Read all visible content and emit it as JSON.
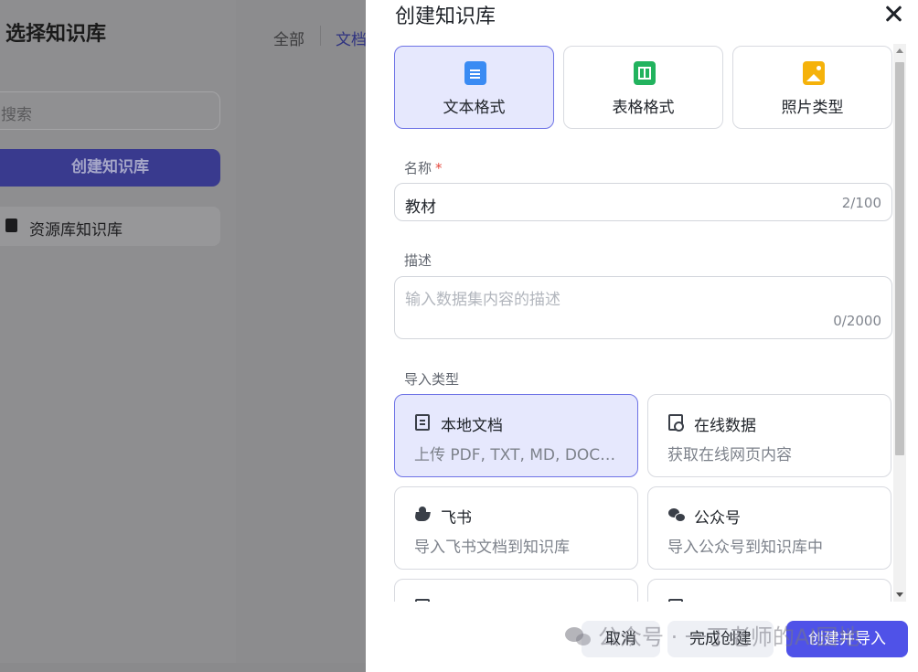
{
  "background": {
    "title": "选择知识库",
    "search_placeholder": "搜索",
    "create_button": "创建知识库",
    "list_items": [
      {
        "label": "资源库知识库"
      }
    ],
    "tabs": [
      {
        "label": "全部"
      },
      {
        "label": "文档"
      }
    ]
  },
  "drawer": {
    "title": "创建知识库",
    "format_options": [
      {
        "label": "文本格式",
        "icon": "text-doc-icon",
        "selected": true
      },
      {
        "label": "表格格式",
        "icon": "table-icon",
        "selected": false
      },
      {
        "label": "照片类型",
        "icon": "photo-icon",
        "selected": false
      }
    ],
    "name": {
      "label": "名称",
      "required_mark": "*",
      "value": "教材",
      "counter": "2/100"
    },
    "description": {
      "label": "描述",
      "placeholder": "输入数据集内容的描述",
      "counter": "0/2000"
    },
    "import_type": {
      "label": "导入类型",
      "options": [
        {
          "title": "本地文档",
          "desc": "上传 PDF, TXT, MD, DOC, CSV 等格式的本地文件",
          "icon": "file-icon",
          "selected": true
        },
        {
          "title": "在线数据",
          "desc": "获取在线网页内容",
          "icon": "web-icon",
          "selected": false
        },
        {
          "title": "飞书",
          "desc": "导入飞书文档到知识库",
          "icon": "feishu-icon",
          "selected": false
        },
        {
          "title": "公众号",
          "desc": "导入公众号到知识库中",
          "icon": "wechat-icon",
          "selected": false
        }
      ]
    },
    "footer": {
      "cancel": "取消",
      "finish": "完成创建",
      "create_import": "创建并导入"
    }
  },
  "watermark": "公众号 · 一丁老师的AI园地",
  "colors": {
    "accent": "#4f52e8",
    "selected_bg": "#e6e8fd",
    "selected_border": "#6e73e6",
    "required": "#e5483d"
  }
}
